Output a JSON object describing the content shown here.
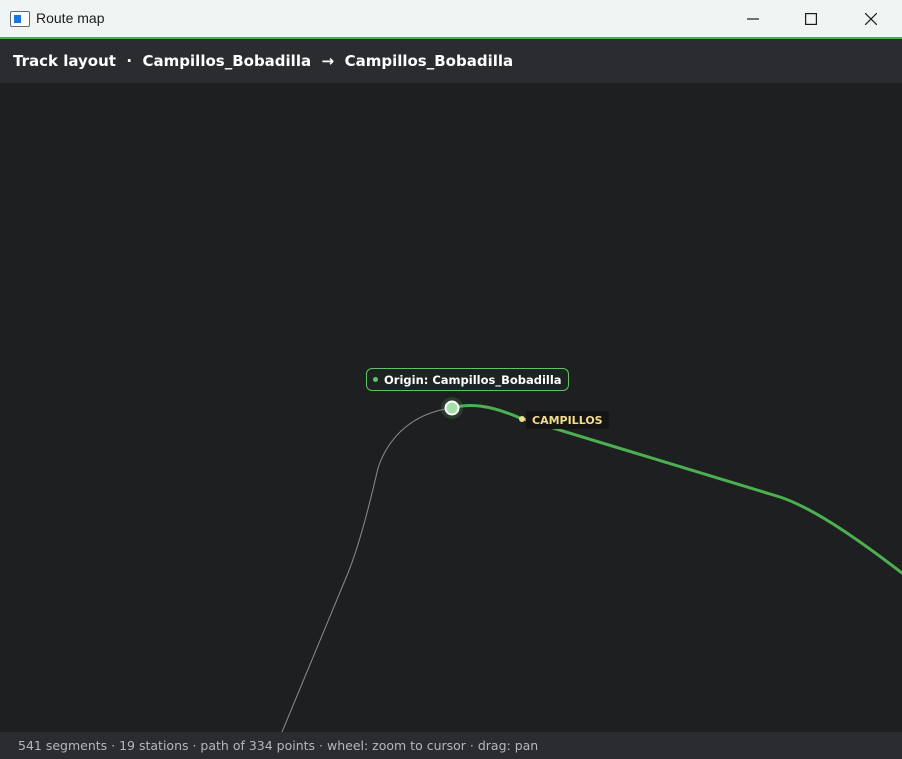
{
  "window": {
    "title": "Route map",
    "controls": [
      "minimize",
      "maximize",
      "close"
    ]
  },
  "header": {
    "prefix": "Track layout",
    "separator": "·",
    "origin": "Campillos_Bobadilla",
    "arrow": "→",
    "destination": "Campillos_Bobadilla"
  },
  "map": {
    "origin_label": "Origin: Campillos_Bobadilla",
    "station_label": "CAMPILLOS",
    "colors": {
      "route": "#4caf50",
      "track": "#8a8c8e",
      "station": "#f3dc8a",
      "origin_marker": "#62c266"
    }
  },
  "status": {
    "text": "541 segments · 19 stations · path of 334 points · wheel: zoom to cursor · drag: pan"
  }
}
